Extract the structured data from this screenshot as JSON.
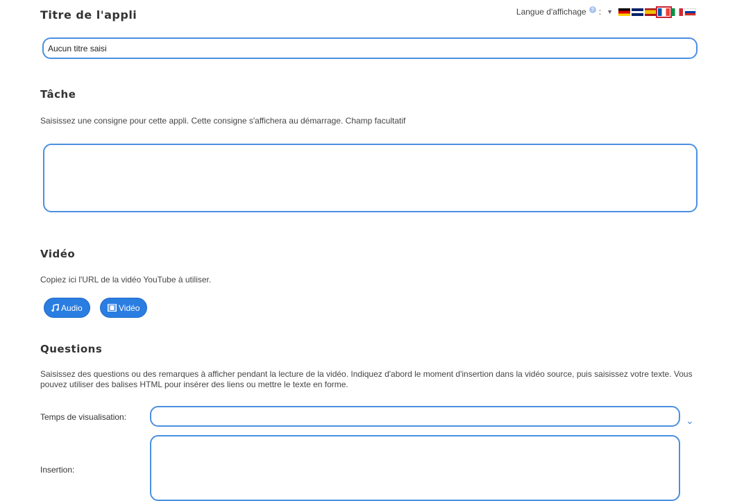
{
  "app_title": {
    "heading": "Titre de l'appli",
    "input_value": "Aucun titre saisi"
  },
  "language": {
    "label": "Langue d'affichage",
    "separator": ":",
    "flags": [
      {
        "name": "german-flag",
        "colors": [
          "#000000",
          "#dd0000",
          "#ffce00"
        ]
      },
      {
        "name": "british-flag",
        "colors": [
          "#012169",
          "#ffffff",
          "#c8102e"
        ]
      },
      {
        "name": "spanish-flag",
        "colors": [
          "#aa151b",
          "#f1bf00",
          "#aa151b"
        ]
      },
      {
        "name": "french-flag",
        "colors": [
          "#0055a4",
          "#ffffff",
          "#ef4135"
        ],
        "selected": true
      },
      {
        "name": "italian-flag",
        "colors": [
          "#009246",
          "#ffffff",
          "#ce2b37"
        ]
      },
      {
        "name": "russian-flag",
        "colors": [
          "#ffffff",
          "#0039a6",
          "#d52b1e"
        ]
      }
    ]
  },
  "task": {
    "heading": "Tâche",
    "description": "Saisissez une consigne pour cette appli. Cette consigne s'affichera au démarrage. Champ facultatif",
    "value": ""
  },
  "video": {
    "heading": "Vidéo",
    "description": "Copiez ici l'URL de la vidéo YouTube à utiliser.",
    "audio_button": "Audio",
    "video_button": "Vidéo"
  },
  "questions": {
    "heading": "Questions",
    "description": "Saisissez des questions ou des remarques à afficher pendant la lecture de la vidéo. Indiquez d'abord le moment d'insertion dans la vidéo source, puis saisissez votre texte. Vous pouvez utiliser des balises HTML pour insérer des liens ou mettre le texte en forme.",
    "time_label": "Temps de visualisation:",
    "time_value": "",
    "insertion_label": "Insertion:",
    "insertion_value": ""
  },
  "colors": {
    "accent": "#2a7de1",
    "field_border": "#4a8fe0"
  }
}
